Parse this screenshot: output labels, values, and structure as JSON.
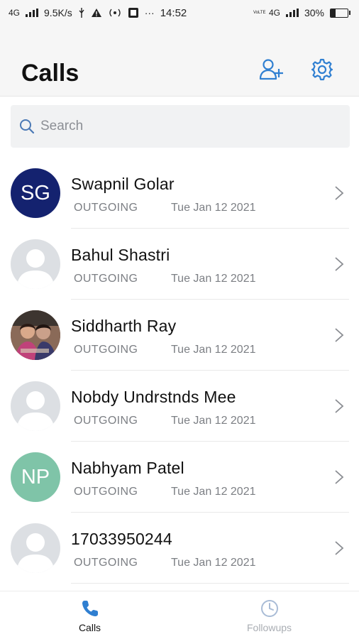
{
  "status_bar": {
    "network": "4G",
    "speed": "9.5K/s",
    "time": "14:52",
    "more": "···",
    "volte": "VoLTE",
    "network_right": "4G",
    "battery": "30%",
    "battery_level": 0.3
  },
  "header": {
    "title": "Calls",
    "add_contact_icon": "add-user-icon",
    "settings_icon": "gear-icon",
    "accent_color": "#2f7fd1"
  },
  "search": {
    "placeholder": "Search"
  },
  "calls": [
    {
      "name": "Swapnil Golar",
      "type": "OUTGOING",
      "date": "Tue Jan 12 2021",
      "avatar_initials": "SG",
      "avatar_color": "#14226f"
    },
    {
      "name": "Bahul Shastri",
      "type": "OUTGOING",
      "date": "Tue Jan 12 2021",
      "avatar_initials": "",
      "avatar_color": "#dcdfe3"
    },
    {
      "name": "Siddharth Ray",
      "type": "OUTGOING",
      "date": "Tue Jan 12 2021",
      "avatar_initials": "",
      "avatar_color": "photo"
    },
    {
      "name": "Nobdy Undrstnds Mee",
      "type": "OUTGOING",
      "date": "Tue Jan 12 2021",
      "avatar_initials": "",
      "avatar_color": "#dcdfe3"
    },
    {
      "name": "Nabhyam Patel",
      "type": "OUTGOING",
      "date": "Tue Jan 12 2021",
      "avatar_initials": "NP",
      "avatar_color": "#7fc4a8"
    },
    {
      "name": "17033950244",
      "type": "OUTGOING",
      "date": "Tue Jan 12 2021",
      "avatar_initials": "",
      "avatar_color": "#dcdfe3"
    }
  ],
  "bottom_nav": {
    "calls_label": "Calls",
    "followups_label": "Followups",
    "active_tab": "Calls",
    "active_color": "#2f7fd1",
    "inactive_color": "#a9adb3"
  }
}
